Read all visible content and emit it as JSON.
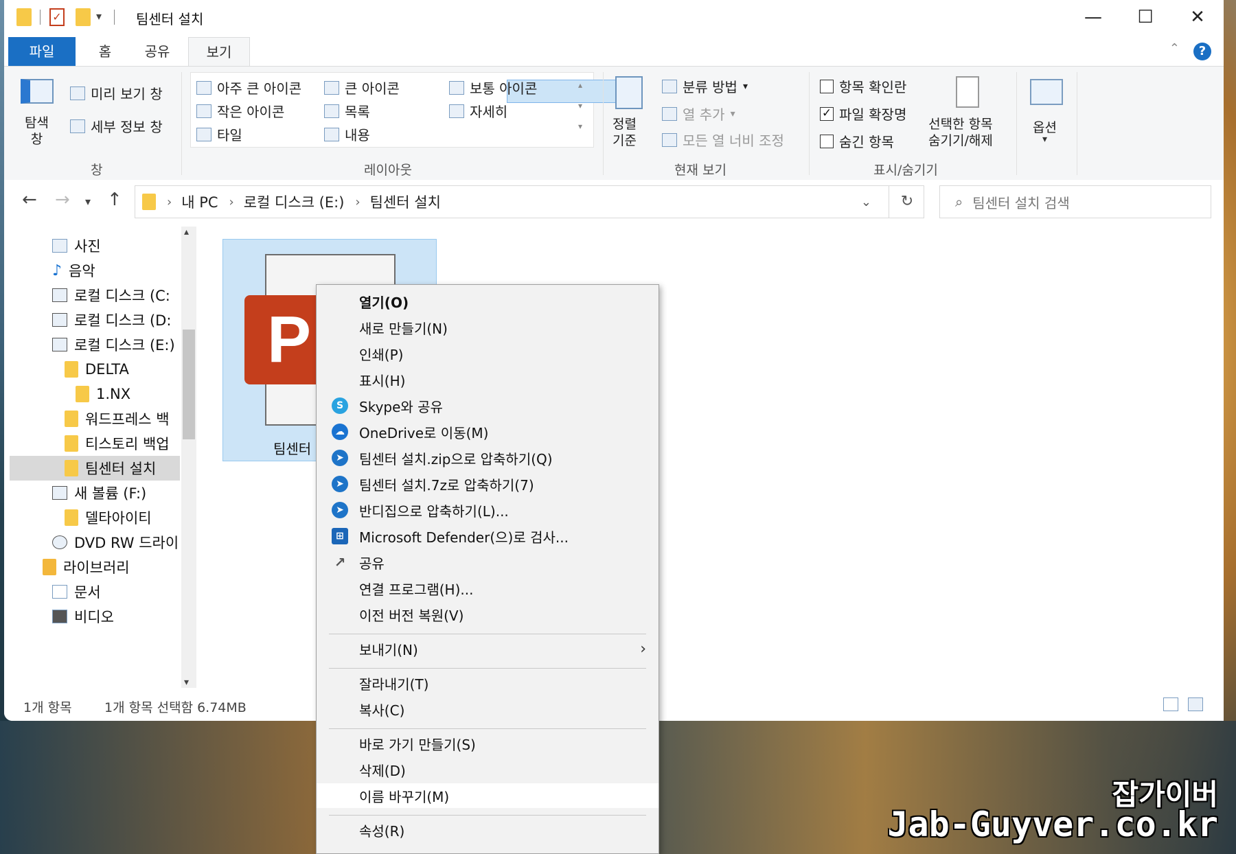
{
  "window": {
    "title": "팀센터 설치",
    "minimize": "—",
    "maximize": "☐",
    "close": "✕"
  },
  "tabs": [
    "파일",
    "홈",
    "공유",
    "보기"
  ],
  "help_label": "?",
  "ribbon": {
    "pane": {
      "nav_pane": "탐색\n창",
      "preview_pane": "미리 보기 창",
      "details_pane": "세부 정보 창",
      "group": "창"
    },
    "layout": {
      "extra_large": "아주 큰 아이콘",
      "large": "큰 아이콘",
      "medium": "보통 아이콘",
      "small": "작은 아이콘",
      "list": "목록",
      "details": "자세히",
      "tiles": "타일",
      "content": "내용",
      "group": "레이아웃"
    },
    "current_view": {
      "sort_by": "정렬\n기준",
      "group_by": "분류 방법",
      "add_columns": "열 추가",
      "size_all_columns": "모든 열 너비 조정",
      "group": "현재 보기"
    },
    "show_hide": {
      "item_checkboxes": "항목 확인란",
      "file_extensions": "파일 확장명",
      "hidden_items": "숨긴 항목",
      "hide_selected": "선택한 항목\n숨기기/해제",
      "group": "표시/숨기기",
      "item_checkboxes_checked": false,
      "file_extensions_checked": true,
      "hidden_items_checked": false
    },
    "options": "옵션"
  },
  "address": {
    "crumbs": [
      "내 PC",
      "로컬 디스크 (E:)",
      "팀센터 설치"
    ],
    "search_placeholder": "팀센터 설치 검색"
  },
  "nav_items": [
    {
      "label": "사진",
      "icon": "pictures-icon"
    },
    {
      "label": "음악",
      "icon": "music-icon"
    },
    {
      "label": "로컬 디스크 (C:",
      "icon": "drive-icon"
    },
    {
      "label": "로컬 디스크 (D:",
      "icon": "drive-icon"
    },
    {
      "label": "로컬 디스크 (E:)",
      "icon": "drive-icon"
    },
    {
      "label": "DELTA",
      "icon": "folder-icon"
    },
    {
      "label": "1.NX",
      "icon": "folder-icon"
    },
    {
      "label": "워드프레스 백",
      "icon": "folder-icon"
    },
    {
      "label": "티스토리 백업",
      "icon": "folder-icon"
    },
    {
      "label": "팀센터 설치",
      "icon": "folder-icon",
      "selected": true
    },
    {
      "label": "새 볼륨 (F:)",
      "icon": "drive-icon"
    },
    {
      "label": "델타아이티",
      "icon": "folder-icon"
    },
    {
      "label": "DVD RW 드라이",
      "icon": "dvd-icon"
    },
    {
      "label": "라이브러리",
      "icon": "library-icon"
    },
    {
      "label": "문서",
      "icon": "documents-icon"
    },
    {
      "label": "비디오",
      "icon": "videos-icon"
    }
  ],
  "file": {
    "name": "팀센터",
    "badge": "P"
  },
  "status": {
    "count": "1개 항목",
    "selection": "1개 항목 선택함 6.74MB"
  },
  "context_menu": [
    {
      "label": "열기(O)",
      "bold": true
    },
    {
      "label": "새로 만들기(N)"
    },
    {
      "label": "인쇄(P)"
    },
    {
      "label": "표시(H)"
    },
    {
      "label": "Skype와 공유",
      "icon": "skype-icon",
      "color": "#2aa3e0",
      "glyph": "S"
    },
    {
      "label": "OneDrive로 이동(M)",
      "icon": "onedrive-icon",
      "color": "#1a73d1",
      "glyph": "☁"
    },
    {
      "label": "팀센터 설치.zip으로 압축하기(Q)",
      "icon": "bandizip-icon",
      "color": "#1e74c8",
      "glyph": "➤"
    },
    {
      "label": "팀센터 설치.7z로 압축하기(7)",
      "icon": "bandizip-icon",
      "color": "#1e74c8",
      "glyph": "➤"
    },
    {
      "label": "반디집으로 압축하기(L)...",
      "icon": "bandizip-icon",
      "color": "#1e74c8",
      "glyph": "➤"
    },
    {
      "label": "Microsoft Defender(으)로 검사...",
      "icon": "defender-icon",
      "color": "#1b66b8",
      "glyph": "⊞"
    },
    {
      "label": "공유",
      "icon": "share-icon",
      "color": "#666666",
      "glyph": "↗"
    },
    {
      "label": "연결 프로그램(H)..."
    },
    {
      "label": "이전 버전 복원(V)"
    },
    {
      "label": "보내기(N)",
      "submenu": true
    },
    {
      "label": "잘라내기(T)"
    },
    {
      "label": "복사(C)"
    },
    {
      "label": "바로 가기 만들기(S)"
    },
    {
      "label": "삭제(D)"
    },
    {
      "label": "이름 바꾸기(M)",
      "hover": true
    },
    {
      "label": "속성(R)"
    }
  ],
  "watermark": {
    "korean": "잡가이버",
    "url": "Jab-Guyver.co.kr"
  }
}
